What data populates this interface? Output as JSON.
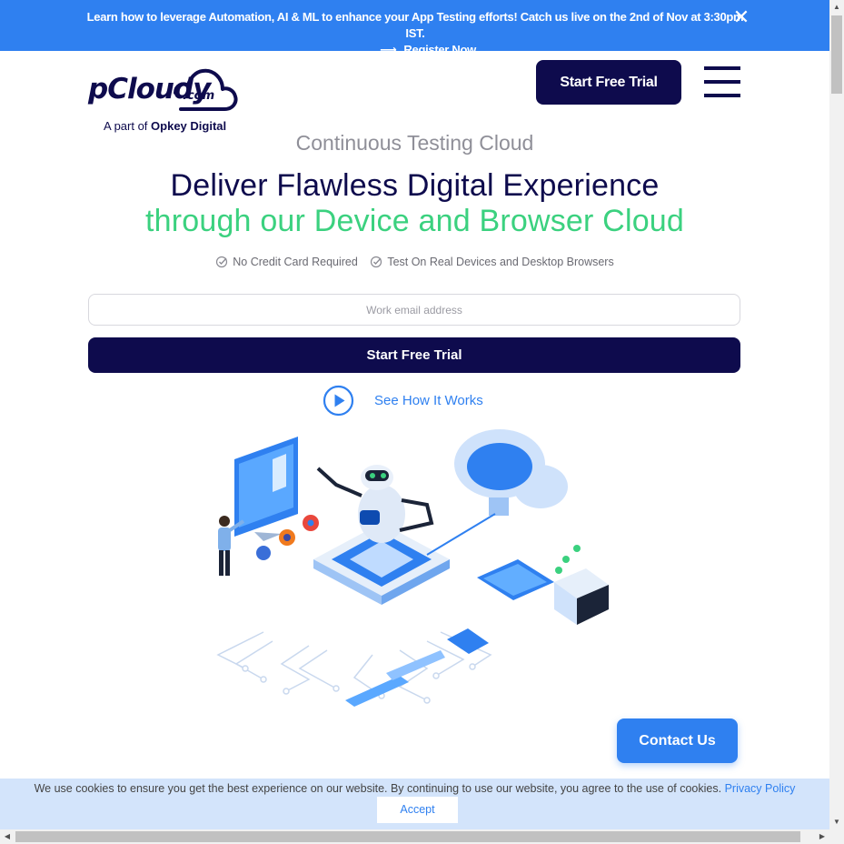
{
  "announcement": {
    "text": "Learn how to leverage Automation, AI & ML to enhance your App Testing efforts! Catch us live on the 2nd of Nov at 3:30pm IST.",
    "link_label": "Register Now",
    "arrow_glyph": "⟶",
    "close_glyph": "✕",
    "bg_color": "#2f80f0"
  },
  "header": {
    "logo_word": "pCloudy",
    "logo_suffix": ".com",
    "logo_tagline_prefix": "A part of ",
    "logo_tagline_brand": "Opkey Digital",
    "cta_label": "Start Free Trial",
    "menu_icon": "hamburger-menu-icon"
  },
  "hero": {
    "eyebrow": "Continuous Testing Cloud",
    "headline_line1": "Deliver Flawless Digital Experience",
    "headline_line2": "through our Device and Browser Cloud",
    "features": [
      "No Credit Card Required",
      "Test On Real Devices and Desktop Browsers"
    ],
    "email_placeholder": "Work email address",
    "cta_label": "Start Free Trial",
    "video_link_label": "See How It Works",
    "accent_green": "#3bd17f",
    "navy": "#0e0b4d"
  },
  "contact": {
    "label": "Contact Us"
  },
  "cookie": {
    "text": "We use cookies to ensure you get the best experience on our website. By continuing to use our website, you agree to the use of cookies.",
    "link_label": "Privacy Policy",
    "accept_label": "Accept"
  }
}
